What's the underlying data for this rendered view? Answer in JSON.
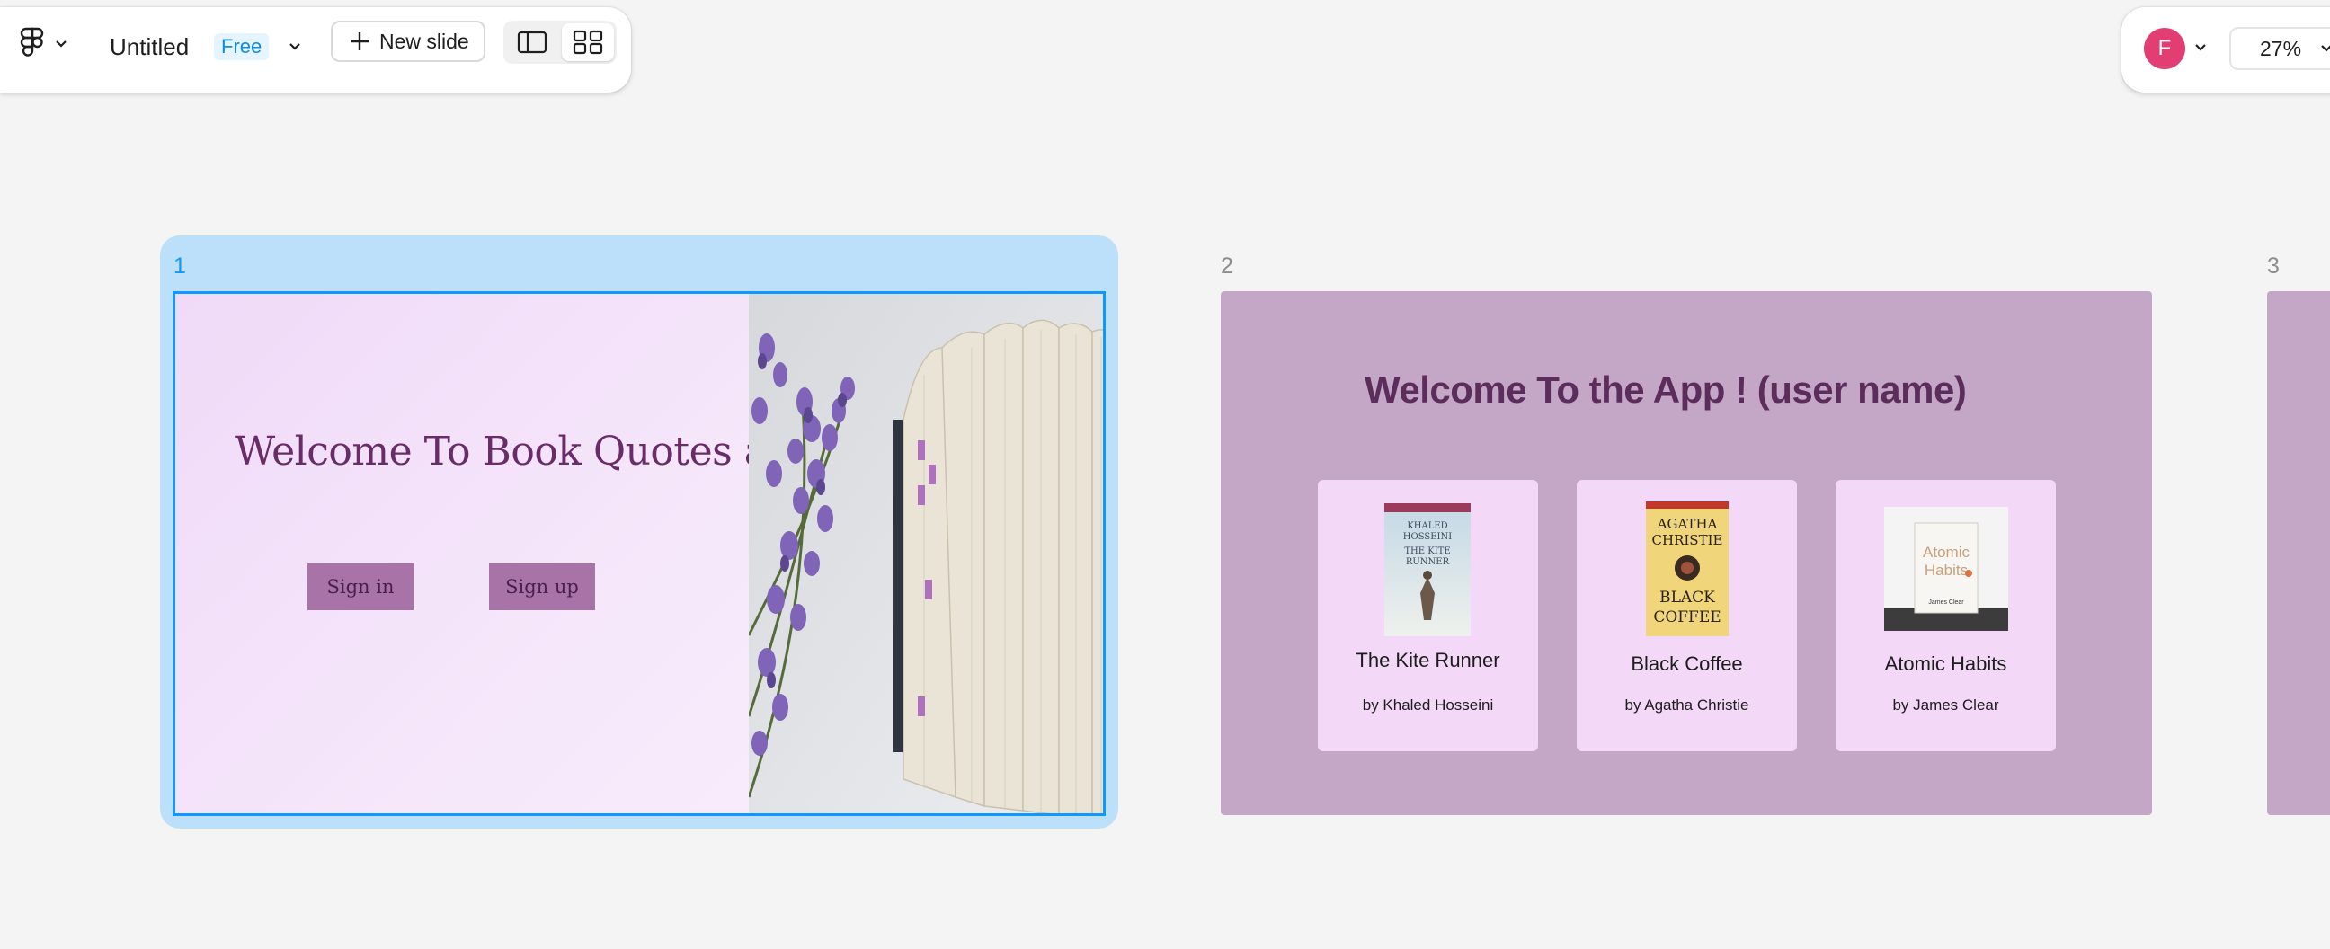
{
  "toolbar": {
    "file_title": "Untitled",
    "plan_badge": "Free",
    "new_slide_label": "New slide"
  },
  "user": {
    "avatar_initial": "F",
    "zoom": "27%"
  },
  "slides": [
    {
      "number": "1",
      "title": "Welcome To Book Quotes app",
      "buttons": [
        "Sign in",
        "Sign up"
      ]
    },
    {
      "number": "2",
      "title": "Welcome To the App ! (user name)",
      "books": [
        {
          "title": "The Kite Runner",
          "author": "by  Khaled Hosseini",
          "cover_text": [
            "KHALED",
            "HOSSEINI",
            "THE KITE",
            "RUNNER"
          ]
        },
        {
          "title": "Black Coffee",
          "author": "by Agatha Christie",
          "cover_text": [
            "AGATHA",
            "CHRISTIE",
            "BLACK",
            "COFFEE"
          ]
        },
        {
          "title": "Atomic Habits",
          "author": "by James Clear",
          "cover_text": [
            "Atomic",
            "Habits",
            "James Clear"
          ]
        }
      ]
    },
    {
      "number": "3"
    }
  ],
  "colors": {
    "selection": "#0d99ff",
    "slide1_bg": "#f3e3fa",
    "slide2_bg": "#c4a7c7",
    "card_bg": "#f3d8f8",
    "button_bg": "#a874a8",
    "title_purple": "#6a2c68",
    "avatar": "#e23e74"
  },
  "icons": [
    "figma-logo-icon",
    "chevron-down-icon",
    "plus-icon",
    "single-slide-view-icon",
    "grid-view-icon"
  ]
}
